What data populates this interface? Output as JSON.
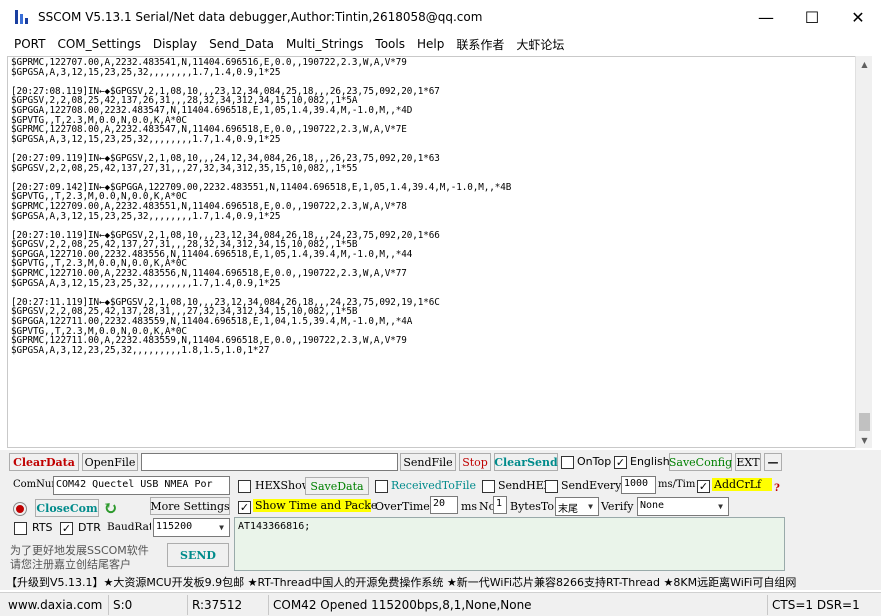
{
  "window": {
    "title": "SSCOM V5.13.1 Serial/Net data debugger,Author:Tintin,2618058@qq.com",
    "minimize": "—",
    "maximize": "☐",
    "close": "✕"
  },
  "menu": [
    "PORT",
    "COM_Settings",
    "Display",
    "Send_Data",
    "Multi_Strings",
    "Tools",
    "Help",
    "联系作者",
    "大虾论坛"
  ],
  "output_lines": [
    "$GPRMC,122707.00,A,2232.483541,N,11404.696516,E,0.0,,190722,2.3,W,A,V*79",
    "$GPGSA,A,3,12,15,23,25,32,,,,,,,,1.7,1.4,0.9,1*25",
    "",
    "[20:27:08.119]IN←◆$GPGSV,2,1,08,10,,,23,12,34,084,25,18,,,26,23,75,092,20,1*67",
    "$GPGSV,2,2,08,25,42,137,26,31,,,28,32,34,312,34,15,10,082,,1*5A",
    "$GPGGA,122708.00,2232.483547,N,11404.696518,E,1,05,1.4,39.4,M,-1.0,M,,*4D",
    "$GPVTG,,T,2.3,M,0.0,N,0.0,K,A*0C",
    "$GPRMC,122708.00,A,2232.483547,N,11404.696518,E,0.0,,190722,2.3,W,A,V*7E",
    "$GPGSA,A,3,12,15,23,25,32,,,,,,,,1.7,1.4,0.9,1*25",
    "",
    "[20:27:09.119]IN←◆$GPGSV,2,1,08,10,,,24,12,34,084,26,18,,,26,23,75,092,20,1*63",
    "$GPGSV,2,2,08,25,42,137,27,31,,,27,32,34,312,35,15,10,082,,1*55",
    "",
    "[20:27:09.142]IN←◆$GPGGA,122709.00,2232.483551,N,11404.696518,E,1,05,1.4,39.4,M,-1.0,M,,*4B",
    "$GPVTG,,T,2.3,M,0.0,N,0.0,K,A*0C",
    "$GPRMC,122709.00,A,2232.483551,N,11404.696518,E,0.0,,190722,2.3,W,A,V*78",
    "$GPGSA,A,3,12,15,23,25,32,,,,,,,,1.7,1.4,0.9,1*25",
    "",
    "[20:27:10.119]IN←◆$GPGSV,2,1,08,10,,,23,12,34,084,26,18,,,24,23,75,092,20,1*66",
    "$GPGSV,2,2,08,25,42,137,27,31,,,28,32,34,312,34,15,10,082,,1*5B",
    "$GPGGA,122710.00,2232.483556,N,11404.696518,E,1,05,1.4,39.4,M,-1.0,M,,*44",
    "$GPVTG,,T,2.3,M,0.0,N,0.0,K,A*0C",
    "$GPRMC,122710.00,A,2232.483556,N,11404.696518,E,0.0,,190722,2.3,W,A,V*77",
    "$GPGSA,A,3,12,15,23,25,32,,,,,,,,1.7,1.4,0.9,1*25",
    "",
    "[20:27:11.119]IN←◆$GPGSV,2,1,08,10,,,23,12,34,084,26,18,,,24,23,75,092,19,1*6C",
    "$GPGSV,2,2,08,25,42,137,28,31,,,27,32,34,312,34,15,10,082,,1*5B",
    "$GPGGA,122711.00,2232.483559,N,11404.696518,E,1,04,1.5,39.4,M,-1.0,M,,*4A",
    "$GPVTG,,T,2.3,M,0.0,N,0.0,K,A*0C",
    "$GPRMC,122711.00,A,2232.483559,N,11404.696518,E,0.0,,190722,2.3,W,A,V*79",
    "$GPGSA,A,3,12,23,25,32,,,,,,,,,1.8,1.5,1.0,1*27"
  ],
  "toolbar": {
    "clear_data": "ClearData",
    "open_file": "OpenFile",
    "file_path": "",
    "send_file": "SendFile",
    "stop": "Stop",
    "clear_send": "ClearSend",
    "on_top": "OnTop",
    "english": "English",
    "save_config": "SaveConfig",
    "ext": "EXT",
    "collapse": "—"
  },
  "port": {
    "com_num_label": "ComNum",
    "com_num_value": "COM42 Quectel USB NMEA Por",
    "close_com": "CloseCom",
    "more_settings": "More Settings",
    "rts": "RTS",
    "dtr": "DTR",
    "baud_label": "BaudRate",
    "baud_value": "115200"
  },
  "options": {
    "hex_show": "HEXShow",
    "save_data": "SaveData",
    "received_to_file": "ReceivedToFile",
    "send_hex": "SendHEX",
    "send_every": "SendEvery:",
    "send_every_value": "1000",
    "send_every_unit": "ms/Tim",
    "add_crlf": "AddCrLf",
    "question": "?",
    "show_time": "Show Time and Packe",
    "overtime_label": "OverTime:",
    "overtime_value": "20",
    "ms": "ms",
    "no_label": "No",
    "no_value": "1",
    "bytes_to": "BytesTo",
    "tail_value": "末尾",
    "verify_label": "Verify",
    "verify_value": "None"
  },
  "promo_text_1": "为了更好地发展SSCOM软件",
  "promo_text_2": "请您注册嘉立创结尾客户",
  "send_button": "SEND",
  "send_text": "AT\u0013143366816;",
  "ad_text": "【升级到V5.13.1】★大资源MCU开发板9.9包邮 ★RT-Thread中国人的开源免费操作系统 ★新一代WiFi芯片兼容8266支持RT-Thread ★8KM远距离WiFi可自组网",
  "status": {
    "website": "www.daxia.com",
    "sent": "S:0",
    "received": "R:37512",
    "port_state": "COM42 Opened  115200bps,8,1,None,None",
    "lines": "CTS=1 DSR=1"
  },
  "colors": {
    "accent_red": "#c00000",
    "accent_teal": "#008b8b",
    "highlight_yellow": "#ffff00",
    "send_area": "#eaf4ea"
  }
}
